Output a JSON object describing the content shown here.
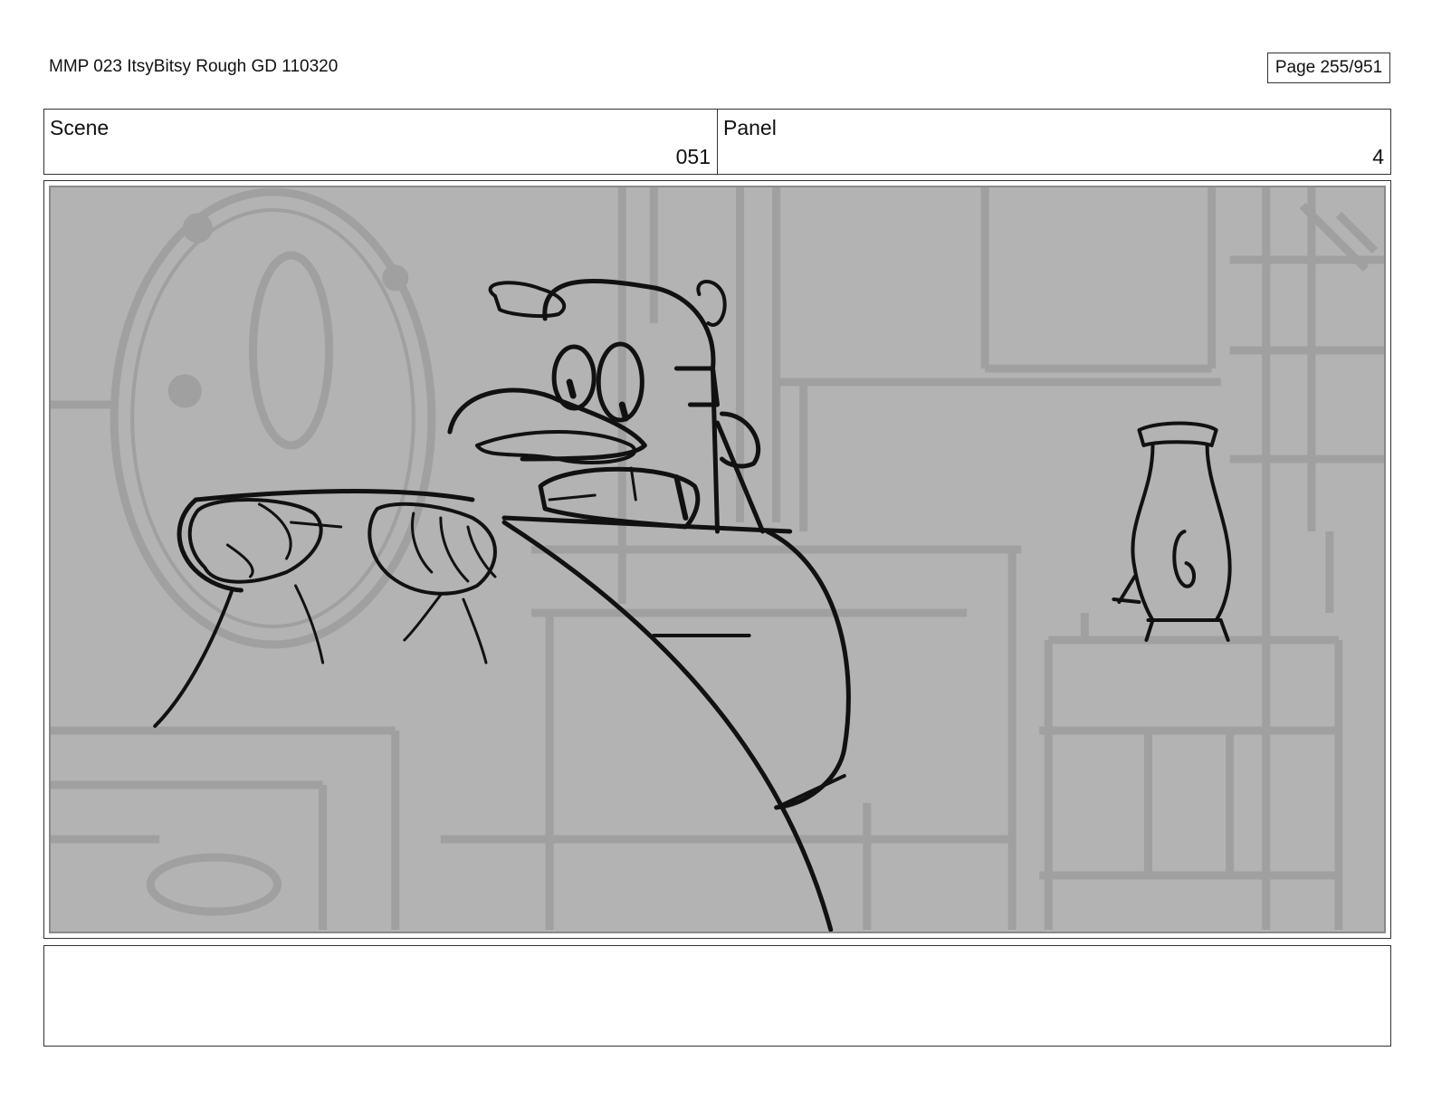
{
  "header": {
    "document_title": "MMP 023 ItsyBitsy Rough GD 110320",
    "page_indicator": "Page 255/951"
  },
  "info": {
    "scene_label": "Scene",
    "scene_value": "051",
    "panel_label": "Panel",
    "panel_value": "4"
  },
  "notes": {
    "text": ""
  }
}
